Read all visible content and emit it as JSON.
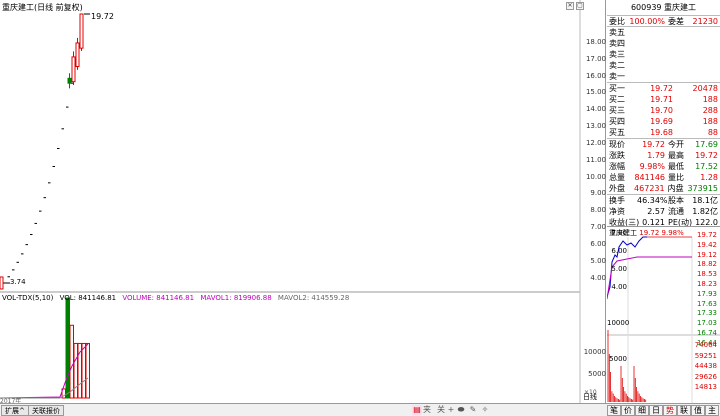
{
  "chart": {
    "title": "重庆建工(日线 前复权)",
    "high_label": "19.72",
    "low_label": "3.74",
    "price_ticks": [
      "18.00",
      "17.00",
      "16.00",
      "15.00",
      "14.00",
      "13.00",
      "12.00",
      "11.00",
      "10.00",
      "9.00",
      "8.00",
      "7.00",
      "6.00",
      "5.00",
      "4.00"
    ],
    "volume_ticks": [
      "10000",
      "5000"
    ],
    "volume_unit": "×10",
    "date_label": "2017年"
  },
  "volume_legend": {
    "indicator": "VOL-TDX(5,10)",
    "vol": "VOL: 841146.81",
    "volume": "VOLUME: 841146.81",
    "mavol1": "MAVOL1: 819906.88",
    "mavol2": "MAVOL2: 414559.28"
  },
  "chart_data": {
    "type": "candlestick",
    "title": "重庆建工(日线 前复权)",
    "ohlc_close": [
      3.74,
      4.11,
      4.52,
      4.97,
      5.47,
      6.02,
      6.62,
      7.28,
      8.01,
      8.81,
      9.69,
      10.66,
      11.73,
      12.9,
      14.19,
      15.61,
      15.9,
      17.17,
      18.0,
      19.72
    ],
    "volume": [],
    "volume_series": [
      {
        "name": "VOLUME",
        "values": [
          2000,
          22000,
          16000,
          12000,
          12000,
          12000,
          12000
        ]
      }
    ],
    "price_range": [
      3.74,
      19.72
    ],
    "last": 19.72
  },
  "quote": {
    "code": "600939",
    "name": "重庆建工",
    "weibi_label": "委比",
    "weibi": "100.00%",
    "weicha_label": "委差",
    "weicha": "21230",
    "sells": [
      {
        "label": "卖五",
        "price": "",
        "vol": ""
      },
      {
        "label": "卖四",
        "price": "",
        "vol": ""
      },
      {
        "label": "卖三",
        "price": "",
        "vol": ""
      },
      {
        "label": "卖二",
        "price": "",
        "vol": ""
      },
      {
        "label": "卖一",
        "price": "",
        "vol": ""
      }
    ],
    "buys": [
      {
        "label": "买一",
        "price": "19.72",
        "vol": "20478"
      },
      {
        "label": "买二",
        "price": "19.71",
        "vol": "188"
      },
      {
        "label": "买三",
        "price": "19.70",
        "vol": "288"
      },
      {
        "label": "买四",
        "price": "19.69",
        "vol": "188"
      },
      {
        "label": "买五",
        "price": "19.68",
        "vol": "88"
      }
    ],
    "stats": [
      {
        "k1": "现价",
        "v1": "19.72",
        "c1": "red",
        "k2": "今开",
        "v2": "17.69",
        "c2": "green"
      },
      {
        "k1": "涨跌",
        "v1": "1.79",
        "c1": "red",
        "k2": "最高",
        "v2": "19.72",
        "c2": "red"
      },
      {
        "k1": "涨幅",
        "v1": "9.98%",
        "c1": "red",
        "k2": "最低",
        "v2": "17.52",
        "c2": "green"
      },
      {
        "k1": "总量",
        "v1": "841146",
        "c1": "red",
        "k2": "量比",
        "v2": "1.28",
        "c2": "red"
      },
      {
        "k1": "外盘",
        "v1": "467231",
        "c1": "red",
        "k2": "内盘",
        "v2": "373915",
        "c2": "green"
      }
    ],
    "fund": [
      {
        "k1": "换手",
        "v1": "46.34%",
        "k2": "股本",
        "v2": "18.1亿"
      },
      {
        "k1": "净资",
        "v1": "2.57",
        "k2": "流通",
        "v2": "1.82亿"
      },
      {
        "k1": "收益(三)",
        "v1": "0.121",
        "k2": "PE(动)",
        "v2": "122.0"
      }
    ]
  },
  "mini": {
    "title": "重庆建工",
    "price": "19.72",
    "pct": "9.98%",
    "left_ticks": [
      "7.00",
      "6.00",
      "5.00",
      "4.00"
    ],
    "right_ticks": [
      "19.72",
      "19.42",
      "19.12",
      "18.82",
      "18.53",
      "18.23",
      "17.93",
      "17.63",
      "17.33",
      "17.03",
      "16.74",
      "16.44"
    ],
    "vol_ticks_left": [
      "10000",
      "5000"
    ],
    "vol_ticks_right": [
      "74064",
      "59251",
      "44438",
      "29626",
      "14813"
    ]
  },
  "bottom": {
    "tabs": [
      "扩展^",
      "关联报价"
    ],
    "day_tab": "日线",
    "right_tabs": [
      "笔",
      "价",
      "细",
      "日",
      "势",
      "联",
      "值",
      "主"
    ],
    "tools": [
      "夹",
      "关"
    ]
  },
  "colors": {
    "up": "#e00000",
    "down": "#008000",
    "accent": "#0000c8",
    "mavol": "#c000c0"
  }
}
